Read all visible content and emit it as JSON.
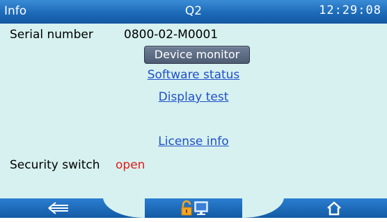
{
  "titlebar": {
    "left": "Info",
    "center": "Q2",
    "time": "12:29:08"
  },
  "info": {
    "serial_label": "Serial number",
    "serial_value": "0800-02-M0001",
    "security_label": "Security switch",
    "security_value": "open"
  },
  "menu": {
    "device_monitor": "Device monitor",
    "software_status": "Software status",
    "display_test": "Display test",
    "license_info": "License info"
  },
  "icons": {
    "back": "back-arrow-icon",
    "lock": "open-lock-icon",
    "monitor": "monitor-icon",
    "home": "home-icon"
  },
  "colors": {
    "accent_blue": "#1c6ab8",
    "background": "#d6f1ef",
    "link": "#1f4fc9",
    "warning_red": "#e11a1a",
    "lock_orange": "#f5a623"
  }
}
